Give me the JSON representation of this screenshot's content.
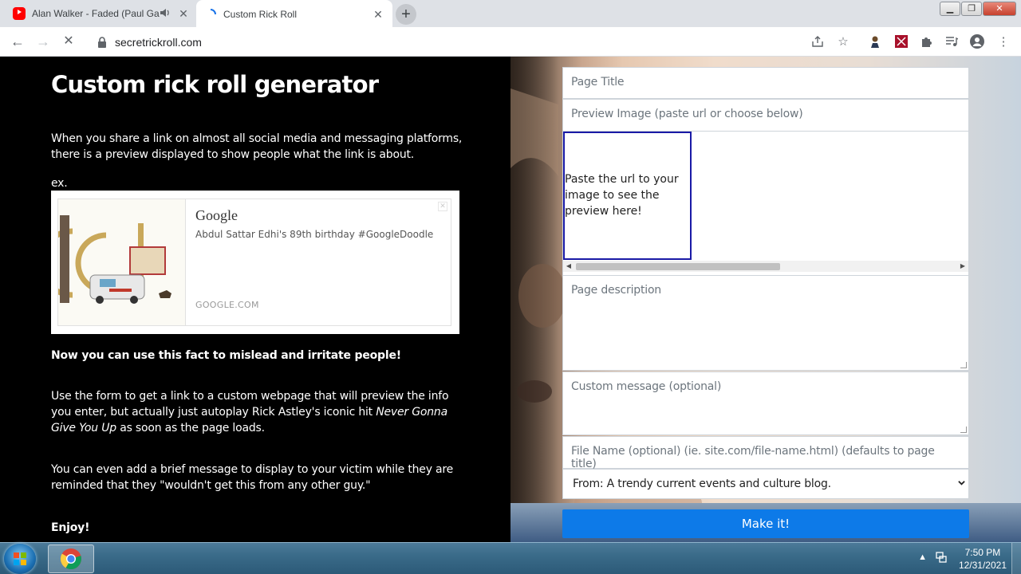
{
  "browser": {
    "tabs": [
      {
        "title": "Alan Walker - Faded (Paul Ga",
        "favicon": "youtube-icon",
        "audio": true
      },
      {
        "title": "Custom Rick Roll",
        "favicon": "loading-icon",
        "active": true
      }
    ],
    "url": "secretrickroll.com"
  },
  "content": {
    "heading": "Custom rick roll generator",
    "intro": "When you share a link on almost all social media and messaging platforms, there is a preview displayed to show people what the link is about.",
    "ex_label": "ex.",
    "example_card": {
      "title": "Google",
      "description": "Abdul Sattar Edhi's 89th birthday #GoogleDoodle",
      "domain": "GOOGLE.COM"
    },
    "mislead": "Now you can use this fact to mislead and irritate people!",
    "use_form_before": "Use the form to get a link to a custom webpage that will preview the info you enter, but actually just autoplay Rick Astley's iconic hit ",
    "use_form_song": "Never Gonna Give You Up",
    "use_form_after": " as soon as the page loads.",
    "brief_message": "You can even add a brief message to display to your victim while they are reminded that they \"wouldn't get this from any other guy.\"",
    "enjoy": "Enjoy!"
  },
  "form": {
    "page_title_placeholder": "Page Title",
    "preview_image_placeholder": "Preview Image (paste url or choose below)",
    "image_preview_text": "Paste the url to your image to see the preview here!",
    "description_placeholder": "Page description",
    "custom_message_placeholder": "Custom message (optional)",
    "file_name_placeholder": "File Name (optional) (ie. site.com/file-name.html) (defaults to page title)",
    "from_selected": "From: A trendy current events and culture blog.",
    "submit_label": "Make it!"
  },
  "taskbar": {
    "time": "7:50 PM",
    "date": "12/31/2021"
  },
  "colors": {
    "button": "#0d7ae8",
    "image_box_border": "#1a1aa6"
  }
}
